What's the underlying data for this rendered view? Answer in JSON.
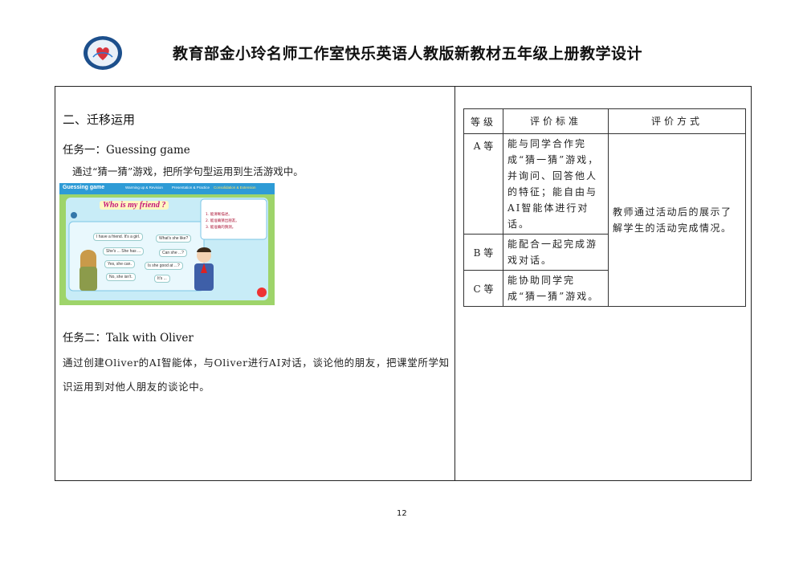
{
  "header": {
    "title": "教育部金小玲名师工作室快乐英语人教版新教材五年级上册教学设计"
  },
  "left": {
    "section_title": "二、迁移运用",
    "task1": {
      "title": "任务一：Guessing game",
      "desc": "通过“猜一猜”游戏，把所学句型运用到生活游戏中。",
      "slide": {
        "tag": "Guessing game",
        "nav": [
          "Warming up & Revision",
          "Presentation & Practice",
          "Consolidation & Extension"
        ],
        "heading": "Who is my friend ?",
        "checklist": [
          "1. 能清晰描述。",
          "2. 能准确猜出朋友。",
          "3. 能准确的猜测。"
        ],
        "bubbles": [
          "I have a friend. It's a girl.",
          "What's she like?",
          "She's ... She has ...",
          "Can she ...?",
          "Yes, she can.",
          "Is she good at ...?",
          "No, she isn't.",
          "It's ..."
        ]
      }
    },
    "task2": {
      "title": "任务二：Talk with Oliver",
      "desc": "通过创建Oliver的AI智能体，与Oliver进行AI对话，谈论他的朋友，把课堂所学知识运用到对他人朋友的谈论中。"
    }
  },
  "eval_table": {
    "headers": [
      "等级",
      "评价标准",
      "评价方式"
    ],
    "rows": [
      {
        "grade": "A 等",
        "criteria": "能与同学合作完成“猜一猜”游戏，并询问、回答他人的特征；能自由与AI智能体进行对话。"
      },
      {
        "grade": "B 等",
        "criteria": "能配合一起完成游戏对话。"
      },
      {
        "grade": "C 等",
        "criteria": "能协助同学完成“猜一猜”游戏。"
      }
    ],
    "method": "教师通过活动后的展示了解学生的活动完成情况。"
  },
  "page_number": "12"
}
